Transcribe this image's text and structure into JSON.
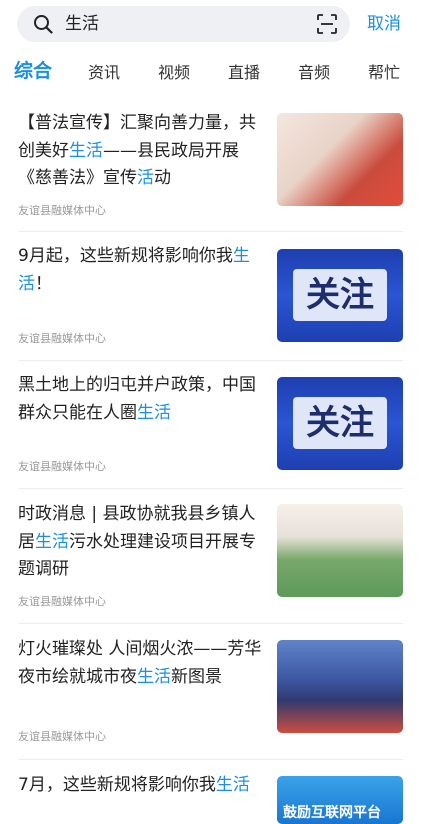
{
  "search": {
    "query": "生活",
    "cancel_label": "取消"
  },
  "tabs": [
    {
      "label": "综合",
      "active": true
    },
    {
      "label": "资讯"
    },
    {
      "label": "视频"
    },
    {
      "label": "直播"
    },
    {
      "label": "音频"
    },
    {
      "label": "帮忙"
    }
  ],
  "results": [
    {
      "title_parts": [
        "【普法宣传】汇聚向善力量，共创美好",
        "生活",
        "——县民政局开展《慈善法》宣传",
        "活",
        "动"
      ],
      "source": "友谊县融媒体中心",
      "thumb": "photo-volunteers"
    },
    {
      "title_parts": [
        "9月起，这些新规将影响你我",
        "生活",
        "！"
      ],
      "source": "友谊县融媒体中心",
      "thumb": "attention-graphic",
      "thumb_text": "关注"
    },
    {
      "title_parts": [
        "黑土地上的归屯并户政策，中国群众只能在人圈",
        "生活"
      ],
      "source": "友谊县融媒体中心",
      "thumb": "attention-graphic",
      "thumb_text": "关注"
    },
    {
      "title_parts": [
        "时政消息 | 县政协就我县乡镇人居",
        "生活",
        "污水处理建设项目开展专题调研"
      ],
      "source": "友谊县融媒体中心",
      "thumb": "photo-meeting"
    },
    {
      "title_parts": [
        "灯火璀璨处 人间烟火浓——芳华夜市绘就城市夜",
        "生活",
        "新图景"
      ],
      "source": "友谊县融媒体中心",
      "thumb": "photo-night-market"
    },
    {
      "title_parts": [
        "7月，这些新规将影响你我",
        "生活"
      ],
      "source": "",
      "thumb": "banner-graphic",
      "thumb_text": "鼓励互联网平台"
    }
  ],
  "colors": {
    "accent": "#1a8fe3",
    "text": "#222222",
    "muted": "#999999"
  }
}
